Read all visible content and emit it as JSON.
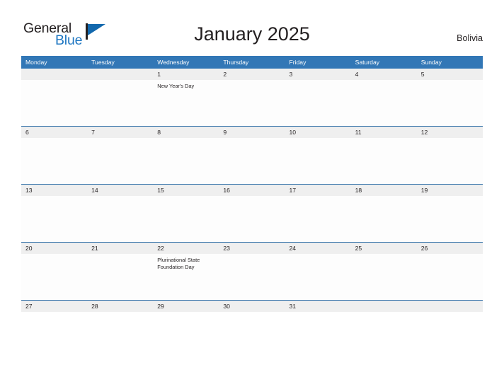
{
  "logo": {
    "word_top": "General",
    "word_bottom": "Blue",
    "flag_icon": "flag-triangle-icon",
    "color_blue": "#1f77c2",
    "color_dark": "#231f20"
  },
  "header": {
    "title": "January 2025",
    "country": "Bolivia"
  },
  "colors": {
    "header_blue": "#3277b6",
    "separator_blue": "#2a6ba5",
    "number_band_gray": "#efefef",
    "cell_white": "#fdfdfd",
    "text_dark": "#231f20",
    "header_text": "#ffffff"
  },
  "calendar": {
    "day_names": [
      "Monday",
      "Tuesday",
      "Wednesday",
      "Thursday",
      "Friday",
      "Saturday",
      "Sunday"
    ],
    "weeks": [
      {
        "days": [
          {
            "number": "",
            "events": []
          },
          {
            "number": "",
            "events": []
          },
          {
            "number": "1",
            "events": [
              "New Year's Day"
            ]
          },
          {
            "number": "2",
            "events": []
          },
          {
            "number": "3",
            "events": []
          },
          {
            "number": "4",
            "events": []
          },
          {
            "number": "5",
            "events": []
          }
        ]
      },
      {
        "days": [
          {
            "number": "6",
            "events": []
          },
          {
            "number": "7",
            "events": []
          },
          {
            "number": "8",
            "events": []
          },
          {
            "number": "9",
            "events": []
          },
          {
            "number": "10",
            "events": []
          },
          {
            "number": "11",
            "events": []
          },
          {
            "number": "12",
            "events": []
          }
        ]
      },
      {
        "days": [
          {
            "number": "13",
            "events": []
          },
          {
            "number": "14",
            "events": []
          },
          {
            "number": "15",
            "events": []
          },
          {
            "number": "16",
            "events": []
          },
          {
            "number": "17",
            "events": []
          },
          {
            "number": "18",
            "events": []
          },
          {
            "number": "19",
            "events": []
          }
        ]
      },
      {
        "days": [
          {
            "number": "20",
            "events": []
          },
          {
            "number": "21",
            "events": []
          },
          {
            "number": "22",
            "events": [
              "Plurinational State Foundation Day"
            ]
          },
          {
            "number": "23",
            "events": []
          },
          {
            "number": "24",
            "events": []
          },
          {
            "number": "25",
            "events": []
          },
          {
            "number": "26",
            "events": []
          }
        ]
      },
      {
        "days": [
          {
            "number": "27",
            "events": []
          },
          {
            "number": "28",
            "events": []
          },
          {
            "number": "29",
            "events": []
          },
          {
            "number": "30",
            "events": []
          },
          {
            "number": "31",
            "events": []
          },
          {
            "number": "",
            "events": []
          },
          {
            "number": "",
            "events": []
          }
        ]
      }
    ]
  }
}
